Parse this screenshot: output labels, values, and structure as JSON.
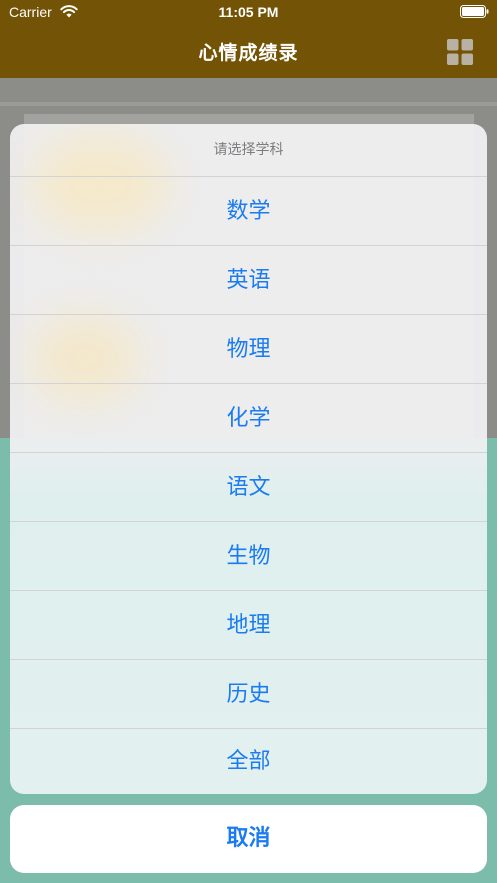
{
  "status_bar": {
    "carrier": "Carrier",
    "time": "11:05 PM"
  },
  "nav": {
    "title": "心情成绩录"
  },
  "action_sheet": {
    "title": "请选择学科",
    "options": [
      "数学",
      "英语",
      "物理",
      "化学",
      "语文",
      "生物",
      "地理",
      "历史",
      "全部"
    ],
    "cancel_label": "取消"
  },
  "colors": {
    "nav_bar_dimmed": "#735305",
    "action_blue": "#1a7cf0",
    "sheet_background": "#f2f2f4",
    "content_teal_dimmed": "#7cbcaa"
  },
  "icons": {
    "status_wifi": "wifi-icon",
    "status_battery": "battery-icon",
    "nav_right": "grid-icon"
  }
}
